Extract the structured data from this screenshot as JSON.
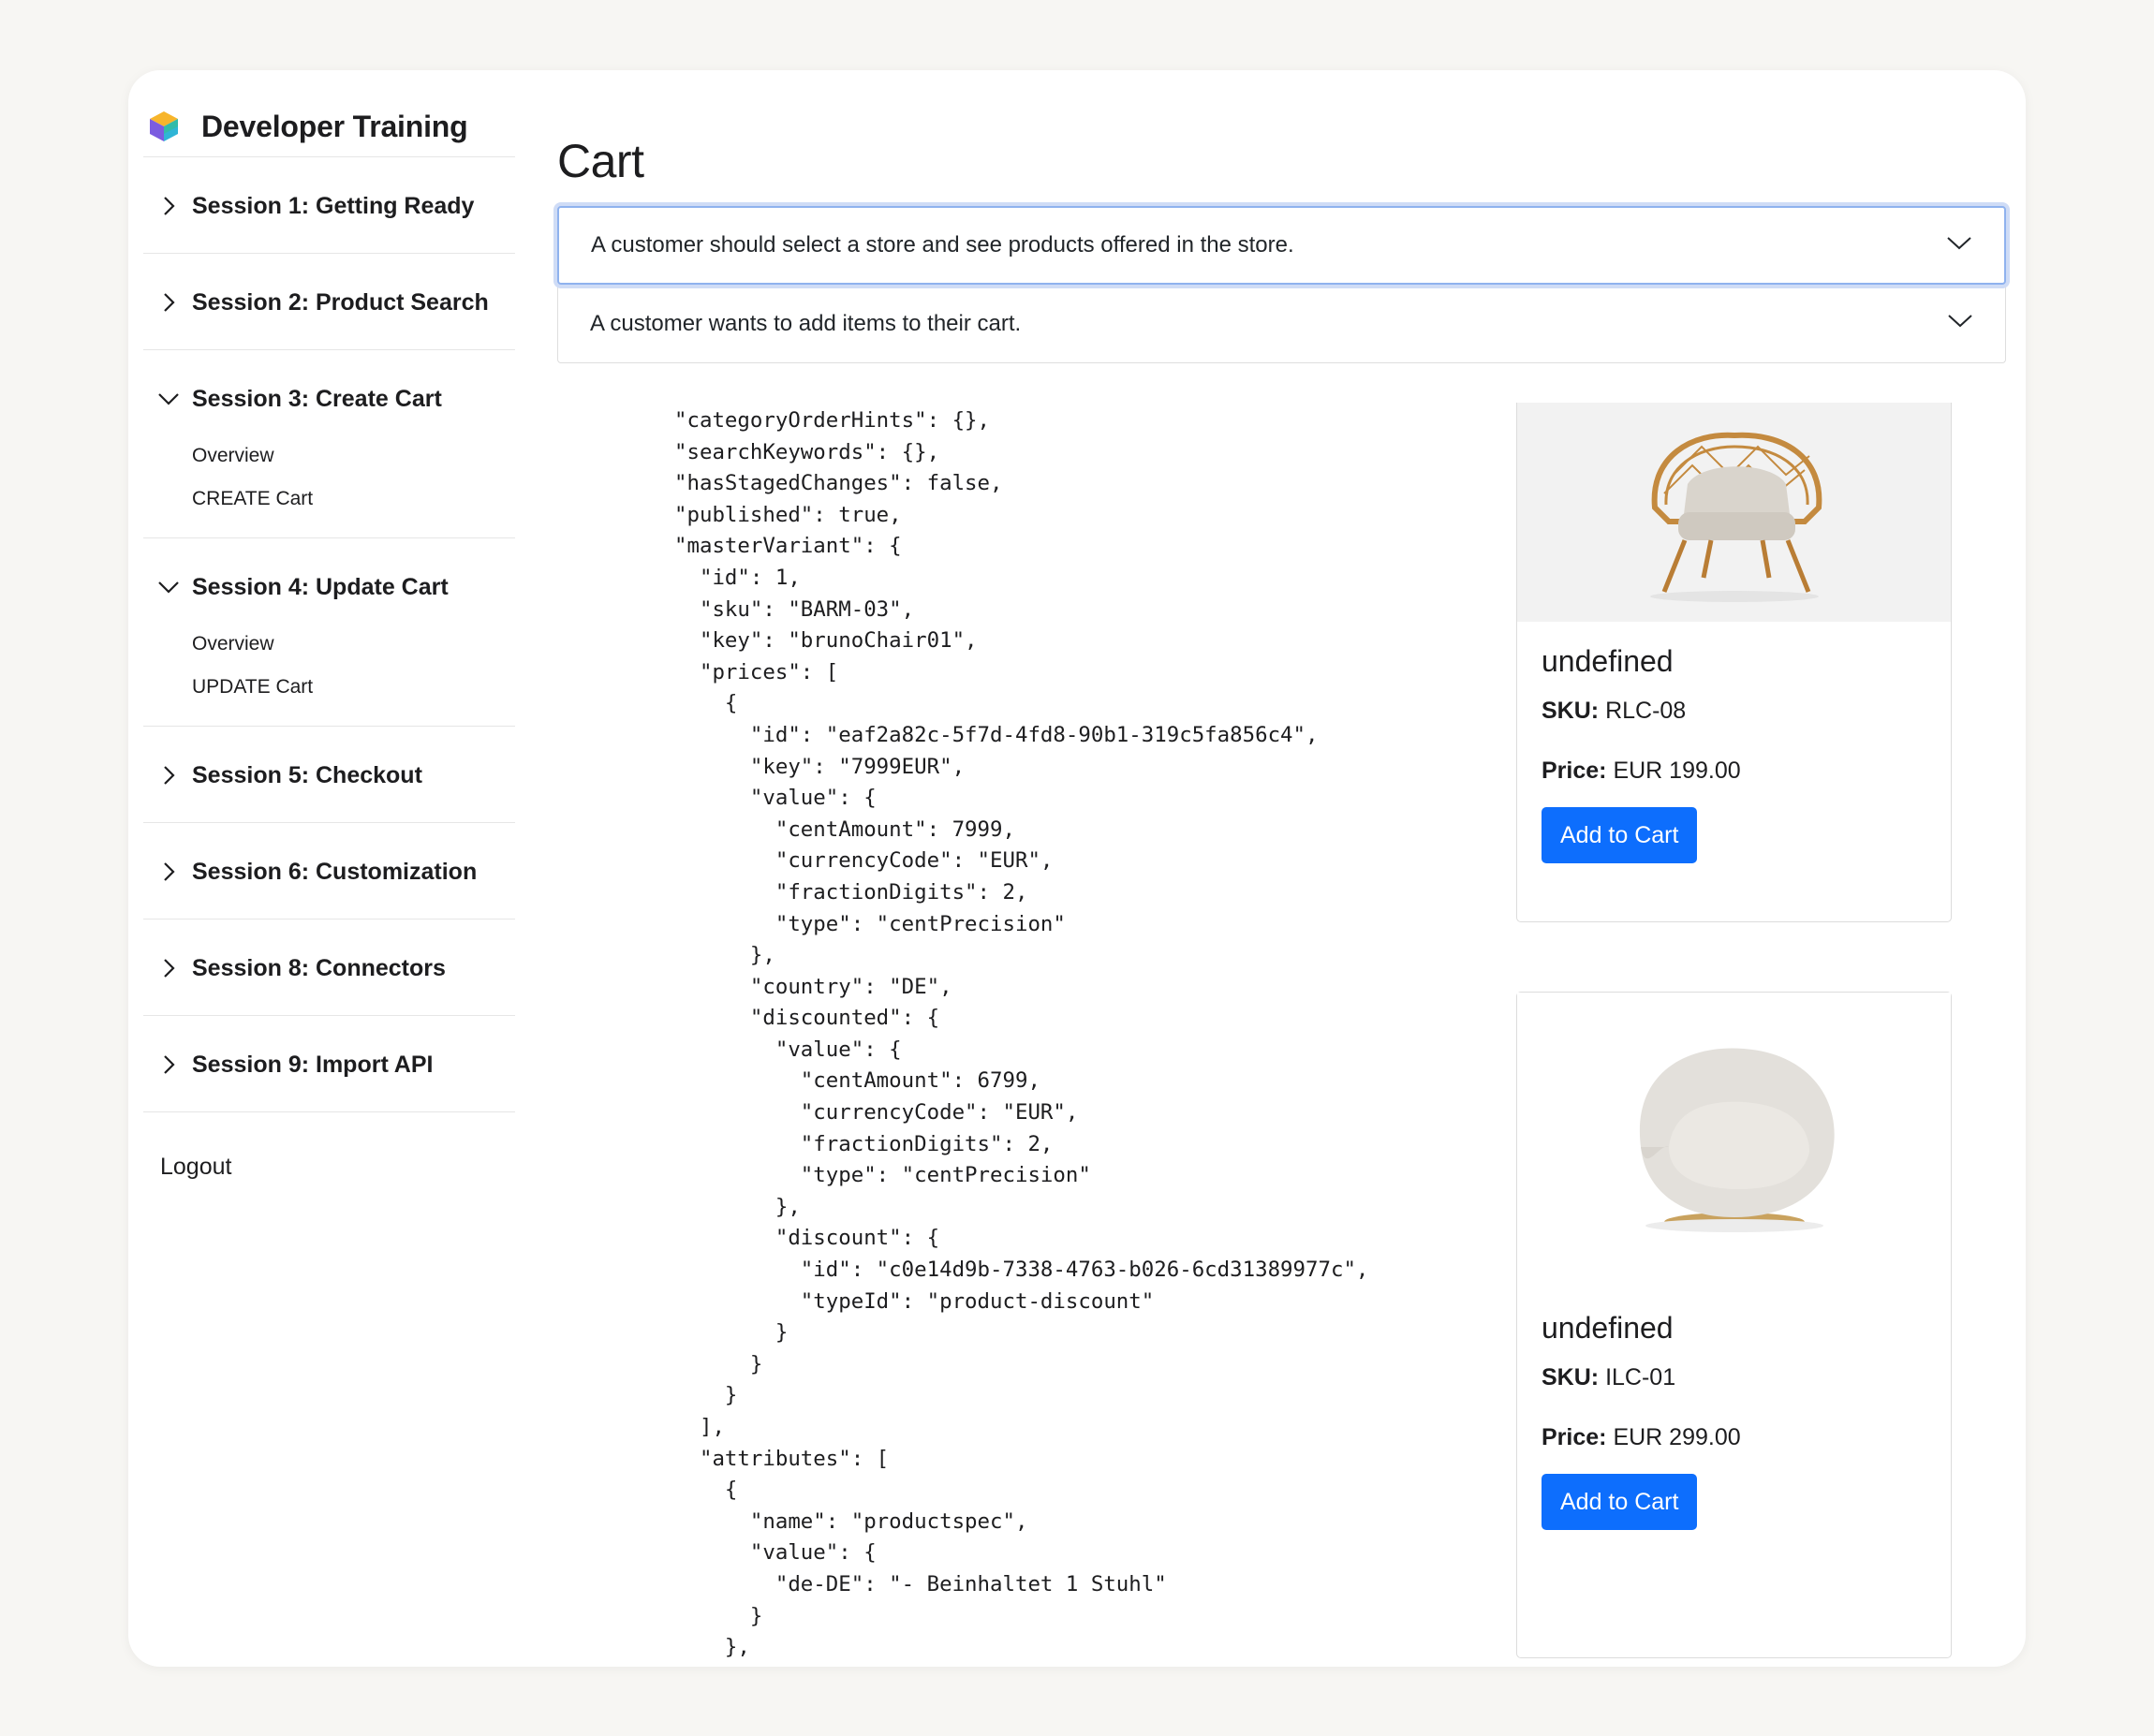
{
  "app": {
    "title": "Developer Training"
  },
  "sidebar": {
    "sections": [
      {
        "label": "Session 1: Getting Ready",
        "expanded": false
      },
      {
        "label": "Session 2: Product Search",
        "expanded": false
      },
      {
        "label": "Session 3: Create Cart",
        "expanded": true,
        "items": [
          "Overview",
          "CREATE Cart"
        ]
      },
      {
        "label": "Session 4: Update Cart",
        "expanded": true,
        "items": [
          "Overview",
          "UPDATE Cart"
        ]
      },
      {
        "label": "Session 5: Checkout",
        "expanded": false
      },
      {
        "label": "Session 6: Customization",
        "expanded": false
      },
      {
        "label": "Session 8: Connectors",
        "expanded": false
      },
      {
        "label": "Session 9: Import API",
        "expanded": false
      }
    ],
    "logout_label": "Logout"
  },
  "main": {
    "title": "Cart",
    "accordion": [
      {
        "text": "A customer should select a store and see products offered in the store.",
        "focused": true
      },
      {
        "text": "A customer wants to add items to their cart.",
        "focused": false
      }
    ],
    "code_lines": [
      "\"categoryOrderHints\": {},",
      "\"searchKeywords\": {},",
      "\"hasStagedChanges\": false,",
      "\"published\": true,",
      "\"masterVariant\": {",
      "  \"id\": 1,",
      "  \"sku\": \"BARM-03\",",
      "  \"key\": \"brunoChair01\",",
      "  \"prices\": [",
      "    {",
      "      \"id\": \"eaf2a82c-5f7d-4fd8-90b1-319c5fa856c4\",",
      "      \"key\": \"7999EUR\",",
      "      \"value\": {",
      "        \"centAmount\": 7999,",
      "        \"currencyCode\": \"EUR\",",
      "        \"fractionDigits\": 2,",
      "        \"type\": \"centPrecision\"",
      "      },",
      "      \"country\": \"DE\",",
      "      \"discounted\": {",
      "        \"value\": {",
      "          \"centAmount\": 6799,",
      "          \"currencyCode\": \"EUR\",",
      "          \"fractionDigits\": 2,",
      "          \"type\": \"centPrecision\"",
      "        },",
      "        \"discount\": {",
      "          \"id\": \"c0e14d9b-7338-4763-b026-6cd31389977c\",",
      "          \"typeId\": \"product-discount\"",
      "        }",
      "      }",
      "    }",
      "  ],",
      "  \"attributes\": [",
      "    {",
      "      \"name\": \"productspec\",",
      "      \"value\": {",
      "        \"de-DE\": \"- Beinhaltet 1 Stuhl\"",
      "      }",
      "    },"
    ],
    "products": [
      {
        "name": "undefined",
        "sku_label": "SKU:",
        "sku": "RLC-08",
        "price_label": "Price:",
        "price": "EUR 199.00",
        "button": "Add to Cart",
        "image": "rattan-armchair"
      },
      {
        "name": "undefined",
        "sku_label": "SKU:",
        "sku": "ILC-01",
        "price_label": "Price:",
        "price": "EUR 299.00",
        "button": "Add to Cart",
        "image": "boucle-armchair"
      }
    ]
  },
  "colors": {
    "primary_button": "#0d6efd",
    "focus_ring": "#8fb2ee"
  }
}
